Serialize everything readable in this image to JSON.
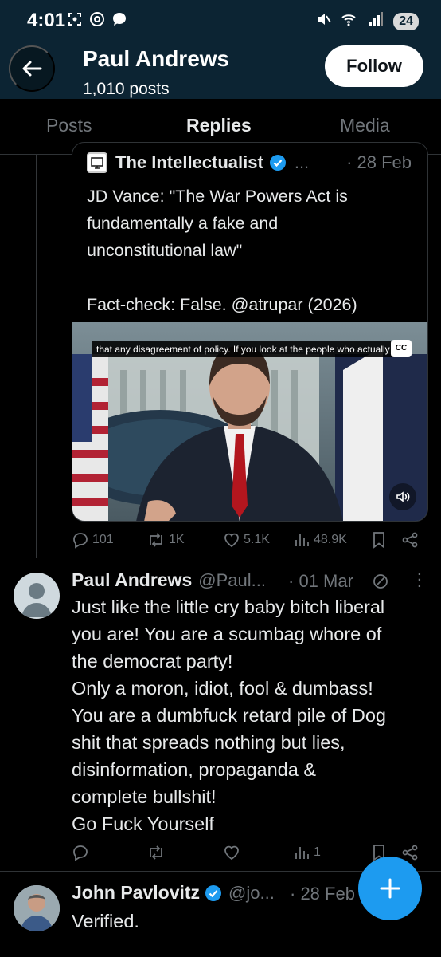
{
  "status_bar": {
    "time": "4:01",
    "left_icons": [
      "screenshot-icon",
      "threads-icon",
      "chat-icon"
    ],
    "right_icons": [
      "mute-icon",
      "wifi-6-icon",
      "signal-icon"
    ],
    "battery": "24"
  },
  "header": {
    "name": "Paul Andrews",
    "posts_count": "1,010 posts",
    "follow_label": "Follow"
  },
  "tabs": [
    {
      "label": "Posts",
      "active": false
    },
    {
      "label": "Replies",
      "active": true
    },
    {
      "label": "Media",
      "active": false
    }
  ],
  "quoted_post": {
    "author": "The Intellectualist",
    "handle": "...",
    "date": "· 28 Feb",
    "text_lines": [
      "JD Vance: \"The War Powers Act is",
      "fundamentally a fake and",
      "unconstitutional law\"",
      "",
      "Fact-check: False. @atrupar (2026)"
    ],
    "video_caption": "that any disagreement of policy. If you look at the people who actually",
    "cc_label": "CC",
    "actions": {
      "replies": "101",
      "reposts": "1K",
      "likes": "5.1K",
      "views": "48.9K"
    }
  },
  "reply_post": {
    "author": "Paul Andrews",
    "handle": "@Paul...",
    "date": "· 01 Mar",
    "more": "⋮",
    "text_lines": [
      "Just like the little cry baby bitch liberal",
      "you are! You are a scumbag whore of",
      "the democrat party!",
      "Only a moron, idiot, fool & dumbass!",
      "You are a dumbfuck retard pile of Dog",
      "shit that spreads nothing but lies,",
      "disinformation, propaganda &",
      "complete bullshit!",
      "Go Fuck Yourself"
    ],
    "actions": {
      "replies": "",
      "reposts": "",
      "likes": "",
      "views": "1"
    }
  },
  "next_post": {
    "author": "John Pavlovitz",
    "handle": "@jo...",
    "date": "· 28 Feb",
    "text": "Verified."
  },
  "fab_label": "+",
  "colors": {
    "header_bg": "#0c2433",
    "accent": "#1d9bf0",
    "muted": "#71767b",
    "text": "#e7e9ea",
    "border": "#2f3336"
  }
}
